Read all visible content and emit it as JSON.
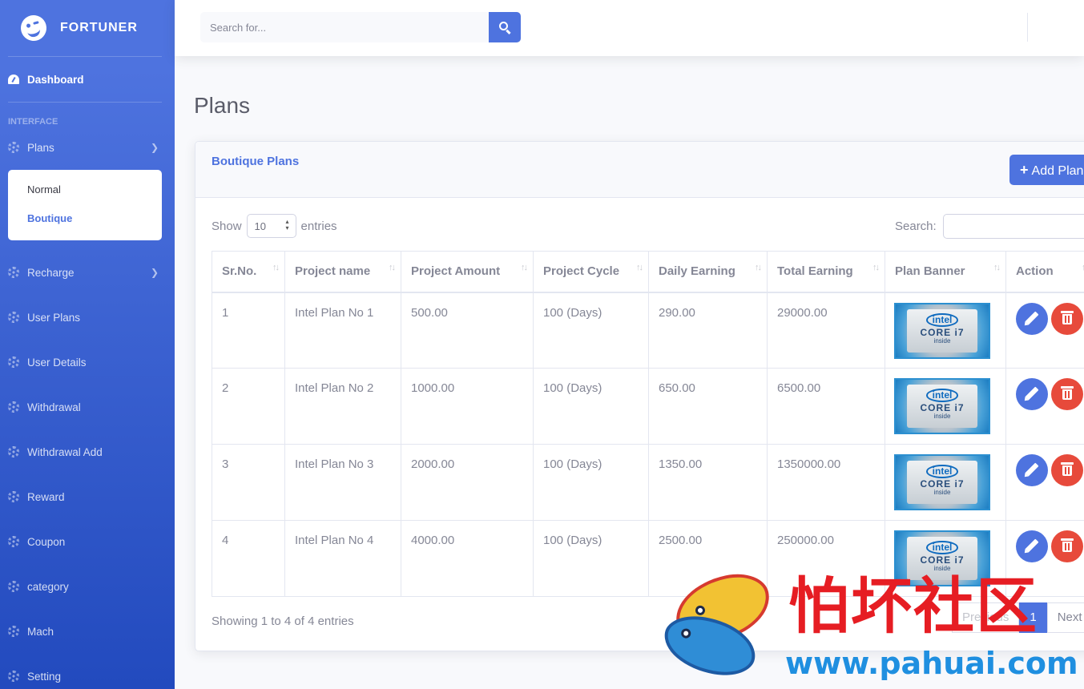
{
  "brand": {
    "name": "FORTUNER"
  },
  "sidebar": {
    "dashboard": "Dashboard",
    "section_heading": "INTERFACE",
    "plans": {
      "label": "Plans",
      "sub_items": [
        "Normal",
        "Boutique"
      ]
    },
    "items": [
      "Recharge",
      "User Plans",
      "User Details",
      "Withdrawal",
      "Withdrawal Add",
      "Reward",
      "Coupon",
      "category",
      "Mach",
      "Setting"
    ]
  },
  "topbar": {
    "search_placeholder": "Search for..."
  },
  "page": {
    "title": "Plans"
  },
  "card": {
    "title": "Boutique Plans",
    "add_button": "Add Plan",
    "show_label": "Show",
    "entries_value": "10",
    "entries_label": "entries",
    "search_label": "Search:",
    "columns": [
      "Sr.No.",
      "Project name",
      "Project Amount",
      "Project Cycle",
      "Daily Earning",
      "Total Earning",
      "Plan Banner",
      "Action"
    ],
    "rows": [
      {
        "sr": "1",
        "name": "Intel Plan No 1",
        "amount": "500.00",
        "cycle": "100 (Days)",
        "daily": "290.00",
        "total": "29000.00"
      },
      {
        "sr": "2",
        "name": "Intel Plan No 2",
        "amount": "1000.00",
        "cycle": "100 (Days)",
        "daily": "650.00",
        "total": "6500.00"
      },
      {
        "sr": "3",
        "name": "Intel Plan No 3",
        "amount": "2000.00",
        "cycle": "100 (Days)",
        "daily": "1350.00",
        "total": "1350000.00"
      },
      {
        "sr": "4",
        "name": "Intel Plan No 4",
        "amount": "4000.00",
        "cycle": "100 (Days)",
        "daily": "2500.00",
        "total": "250000.00"
      }
    ],
    "banner": {
      "brand": "intel",
      "line1": "CORE i7",
      "line2": "inside"
    },
    "info": "Showing 1 to 4 of 4 entries",
    "pager": {
      "previous": "Previous",
      "current": "1",
      "next": "Next"
    }
  },
  "watermark": {
    "text_cn": "怕坏社区",
    "url": "www.pahuai.com"
  },
  "colors": {
    "primary": "#4e73df",
    "danger": "#e74a3b",
    "sidebar_bottom": "#224abe"
  }
}
